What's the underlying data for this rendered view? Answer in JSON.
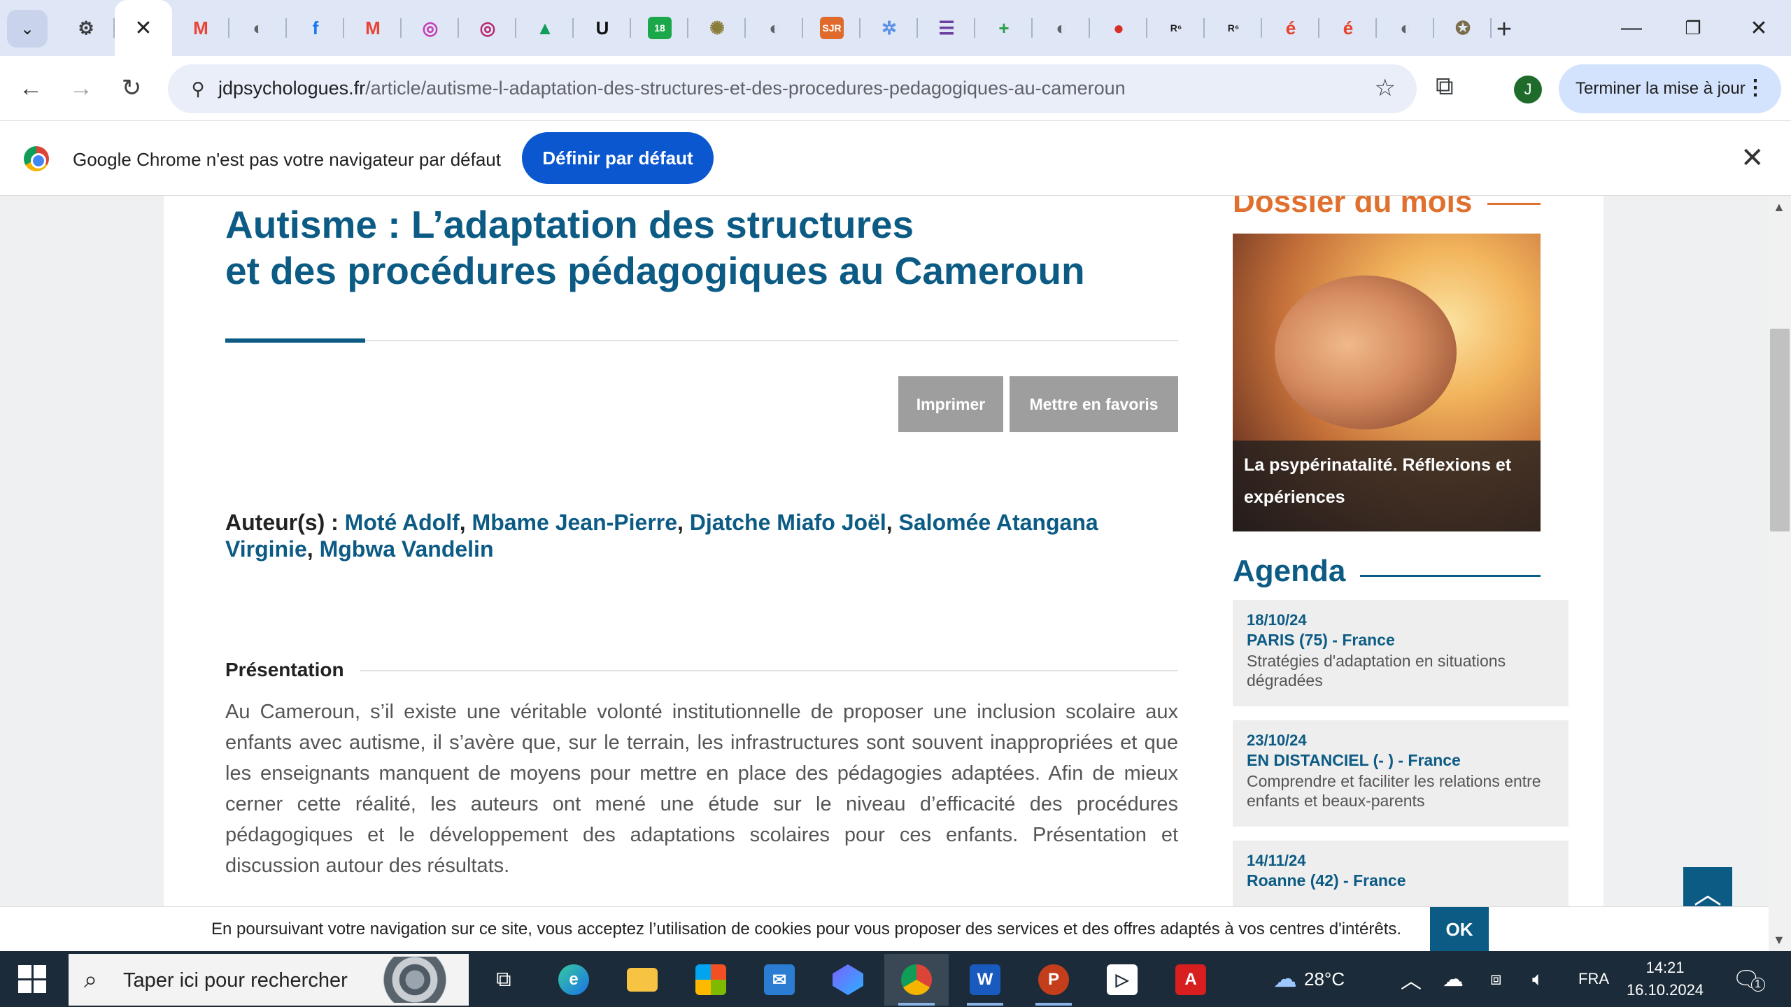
{
  "browser": {
    "tabs": [
      {
        "name": "favicon-settings",
        "glyph": "⚙",
        "color": "#3c4043"
      },
      {
        "name": "favicon-gmail",
        "glyph": "M",
        "color": "#ea4335"
      },
      {
        "name": "favicon-globe",
        "glyph": "◐",
        "color": "#5f6368"
      },
      {
        "name": "favicon-facebook",
        "glyph": "f",
        "color": "#1877f2"
      },
      {
        "name": "favicon-gmail",
        "glyph": "M",
        "color": "#ea4335"
      },
      {
        "name": "favicon-ring",
        "glyph": "◎",
        "color": "#c43ab5"
      },
      {
        "name": "favicon-ring",
        "glyph": "◎",
        "color": "#b8256e"
      },
      {
        "name": "favicon-drive",
        "glyph": "▲",
        "color": "#0f9d58"
      },
      {
        "name": "favicon-u",
        "glyph": "U",
        "color": "#111111"
      },
      {
        "name": "favicon-18",
        "glyph": "18",
        "color": "#1aa84a"
      },
      {
        "name": "favicon-emblem",
        "glyph": "✺",
        "color": "#8a7d3a"
      },
      {
        "name": "favicon-globe",
        "glyph": "◐",
        "color": "#5f6368"
      },
      {
        "name": "favicon-sjr",
        "glyph": "SJR",
        "color": "#e06a2b"
      },
      {
        "name": "favicon-un",
        "glyph": "✲",
        "color": "#5b92e5"
      },
      {
        "name": "favicon-list",
        "glyph": "☰",
        "color": "#6b3fa0"
      },
      {
        "name": "favicon-plus",
        "glyph": "+",
        "color": "#2e9e48"
      },
      {
        "name": "favicon-globe",
        "glyph": "◐",
        "color": "#5f6368"
      },
      {
        "name": "favicon-record",
        "glyph": "●",
        "color": "#d93025"
      },
      {
        "name": "favicon-r6",
        "glyph": "R⁶",
        "color": "#222222"
      },
      {
        "name": "favicon-r6",
        "glyph": "R⁶",
        "color": "#222222"
      },
      {
        "name": "favicon-e-circle",
        "glyph": "é",
        "color": "#e8412c"
      },
      {
        "name": "favicon-e",
        "glyph": "é",
        "color": "#e8412c"
      },
      {
        "name": "favicon-globe",
        "glyph": "◐",
        "color": "#5f6368"
      },
      {
        "name": "favicon-seal",
        "glyph": "✪",
        "color": "#7c6d4a"
      }
    ],
    "url_host": "jdpsychologues.fr",
    "url_path": "/article/autisme-l-adaptation-des-structures-et-des-procedures-pedagogiques-au-cameroun",
    "profile_initial": "J",
    "finish_update_label": "Terminer la mise à jour",
    "default_prompt_text": "Google Chrome n'est pas votre navigateur par défaut",
    "default_button_label": "Définir par défaut"
  },
  "article": {
    "title_line1": "Autisme : L’adaptation des structures",
    "title_line2": "et des procédures pédagogiques au Cameroun",
    "print_label": "Imprimer",
    "favorite_label": "Mettre en favoris",
    "authors_label": "Auteur(s) :",
    "authors": [
      "Moté Adolf",
      "Mbame Jean-Pierre",
      "Djatche Miafo Joël",
      "Salomée Atangana Virginie",
      "Mgbwa Vandelin"
    ],
    "section_title": "Présentation",
    "body": "Au Cameroun, s’il existe une véritable volonté institutionnelle de proposer une inclusion scolaire aux enfants avec autisme, il s’avère que, sur le terrain, les infrastructures sont souvent inappropriées et que les enseignants manquent de moyens pour mettre en place des pédagogies adaptées. Afin de mieux cerner cette réalité, les auteurs ont mené une étude sur le niveau d’efficacité des procédures pédagogiques et le développement des adaptations scolaires pour ces enfants. Présentation et discussion autour des résultats."
  },
  "sidebar": {
    "dossier_heading": "Dossier du mois",
    "dossier_caption": "La psypérinatalité. Réflexions et expériences",
    "agenda_heading": "Agenda",
    "events": [
      {
        "date": "18/10/24",
        "place": "PARIS (75) - France",
        "desc": "Stratégies d'adaptation en situations dégradées"
      },
      {
        "date": "23/10/24",
        "place": "EN DISTANCIEL (- ) - France",
        "desc": "Comprendre et faciliter les relations entre enfants et beaux-parents"
      },
      {
        "date": "14/11/24",
        "place": "Roanne (42) - France",
        "desc": ""
      }
    ]
  },
  "cookie": {
    "text": "En poursuivant votre navigation sur ce site, vous acceptez l’utilisation de cookies pour vous proposer des services et des offres adaptés à vos centres d'intérêts.",
    "ok_label": "OK"
  },
  "taskbar": {
    "search_placeholder": "Taper ici pour rechercher",
    "weather_temp": "28°C",
    "language": "FRA",
    "time": "14:21",
    "date": "16.10.2024",
    "notifications_count": "1"
  },
  "colors": {
    "brand_blue": "#0c5b84",
    "accent_orange": "#e0702e",
    "button_grey": "#9e9e9e"
  }
}
